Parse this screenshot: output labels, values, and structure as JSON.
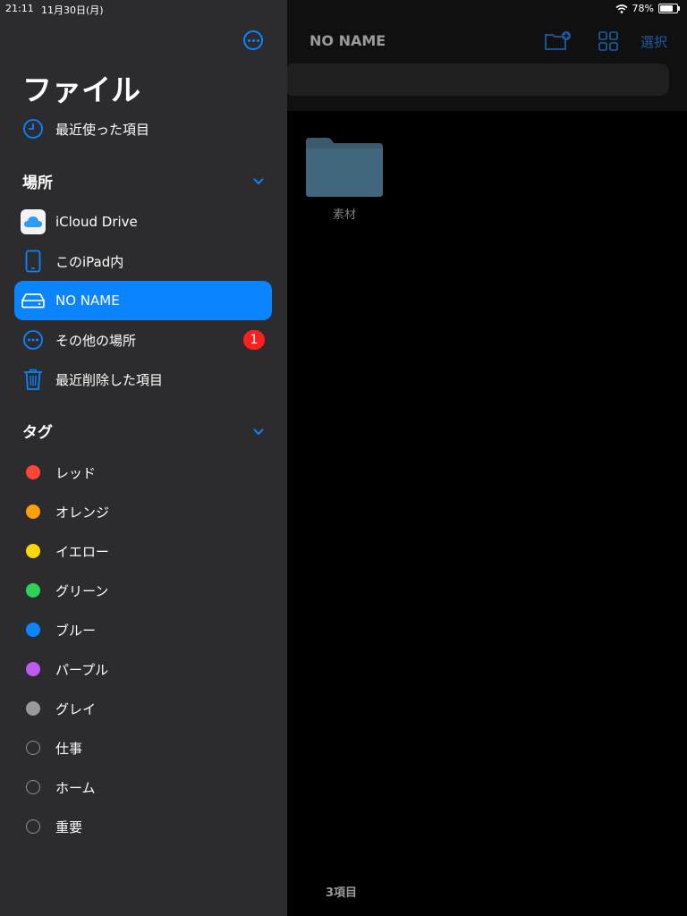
{
  "status_bar": {
    "time": "21:11",
    "date": "11月30日(月)",
    "battery": "78%",
    "battery_level": 0.78
  },
  "main": {
    "title": "NO NAME",
    "select_label": "選択",
    "folder": {
      "name": "素材"
    },
    "item_count": "3項目"
  },
  "sidebar": {
    "title": "ファイル",
    "recents_label": "最近使った項目",
    "locations_header": "場所",
    "locations": [
      {
        "label": "iCloud Drive",
        "icon": "icloud-icon"
      },
      {
        "label": "このiPad内",
        "icon": "ipad-icon"
      },
      {
        "label": "NO NAME",
        "icon": "drive-icon",
        "selected": true
      },
      {
        "label": "その他の場所",
        "icon": "more-locations-icon",
        "badge": "1"
      },
      {
        "label": "最近削除した項目",
        "icon": "trash-icon"
      }
    ],
    "tags_header": "タグ",
    "tags": [
      {
        "label": "レッド",
        "color": "#ff453a"
      },
      {
        "label": "オレンジ",
        "color": "#ff9f0a"
      },
      {
        "label": "イエロー",
        "color": "#ffd60a"
      },
      {
        "label": "グリーン",
        "color": "#30d158"
      },
      {
        "label": "ブルー",
        "color": "#0a84ff"
      },
      {
        "label": "パープル",
        "color": "#bf5af2"
      },
      {
        "label": "グレイ",
        "color": "#98989d"
      },
      {
        "label": "仕事",
        "color": ""
      },
      {
        "label": "ホーム",
        "color": ""
      },
      {
        "label": "重要",
        "color": ""
      }
    ]
  },
  "colors": {
    "accent": "#0a84ff",
    "sidebar_bg": "#2c2c2e",
    "badge": "#ff1f1f"
  }
}
